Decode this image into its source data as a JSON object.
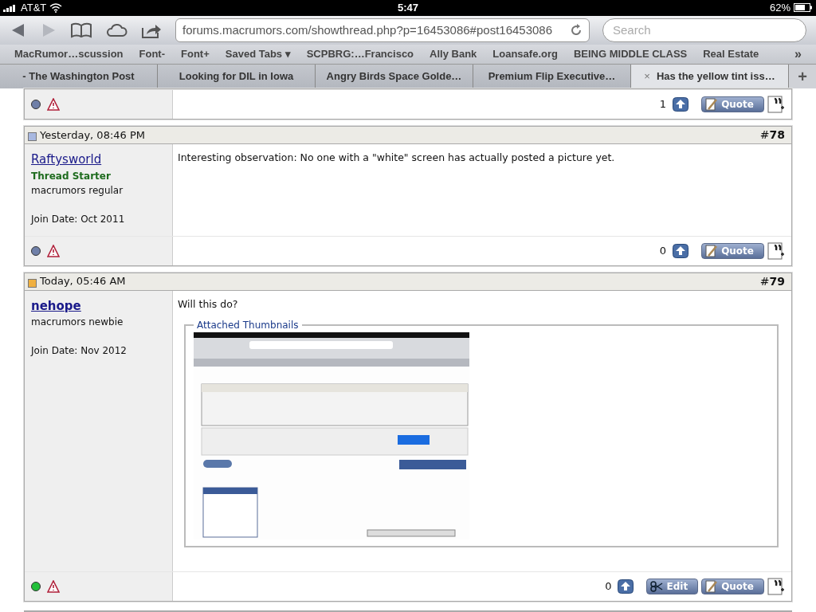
{
  "status_bar": {
    "carrier": "AT&T",
    "time": "5:47",
    "battery": "62%"
  },
  "toolbar": {
    "url": "forums.macrumors.com/showthread.php?p=16453086#post16453086",
    "search": {
      "placeholder": "Search"
    }
  },
  "bookmarks": [
    "MacRumor…scussion",
    "Font-",
    "Font+",
    "Saved Tabs ▾",
    "SCPBRG:…Francisco",
    "Ally Bank",
    "Loansafe.org",
    "BEING MIDDLE CLASS",
    "Real Estate",
    "»"
  ],
  "tabs": [
    {
      "label": "- The Washington Post",
      "selected": false
    },
    {
      "label": "Looking for DIL in Iowa",
      "selected": false
    },
    {
      "label": "Angry Birds Space Golde…",
      "selected": false
    },
    {
      "label": "Premium Flip Executive…",
      "selected": false
    },
    {
      "label": "Has the yellow tint iss…",
      "selected": true,
      "close": "×"
    }
  ],
  "new_tab": "+",
  "posts": [
    {
      "kind": "footer_only",
      "online": false,
      "votes": "1",
      "buttons": [
        {
          "kind": "quote",
          "label": "Quote"
        }
      ]
    },
    {
      "kind": "full",
      "new": false,
      "date": "Yesterday, 08:46 PM",
      "number": "#**78**",
      "user": "Raftysworld",
      "user_bold": false,
      "title": "Thread Starter",
      "rank": "macrumors regular",
      "join": "Join Date: Oct 2011",
      "message": "Interesting observation: No one with a \"white\" screen has actually posted a picture yet.",
      "online": false,
      "votes": "0",
      "buttons": [
        {
          "kind": "quote",
          "label": "Quote"
        }
      ]
    },
    {
      "kind": "full",
      "new": true,
      "date": "Today, 05:46 AM",
      "number": "#**79**",
      "user": "nehope",
      "user_bold": true,
      "rank": "macrumors newbie",
      "join": "Join Date: Nov 2012",
      "message": "Will this do?",
      "attachment": {
        "legend": "Attached Thumbnails",
        "kind": "picture"
      },
      "online": true,
      "votes": "0",
      "buttons": [
        {
          "kind": "edit",
          "label": "Edit"
        },
        {
          "kind": "quote",
          "label": "Quote"
        }
      ]
    }
  ]
}
